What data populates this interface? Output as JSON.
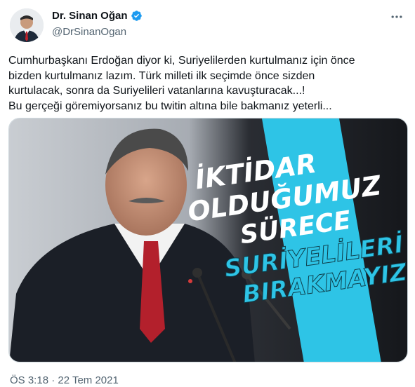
{
  "tweet": {
    "author_name": "Dr. Sinan Oğan",
    "handle": "@DrSinanOgan",
    "verified_icon": "verified-badge-icon",
    "more_icon": "more-horizontal-icon",
    "text_lines": [
      "Cumhurbaşkanı Erdoğan diyor ki, Suriyelilerden kurtulmanız için önce",
      "bizden kurtulmanız lazım. Türk milleti ilk seçimde önce sizden",
      "kurtulacak, sonra da Suriyelileri vatanlarına kavuşturacak...!",
      "Bu gerçeği göremiyorsanız bu twitin altına bile bakmanız yeterli..."
    ],
    "timestamp": "ÖS 3:18 · 22 Tem 2021"
  },
  "media": {
    "lines": [
      "İKTİDAR",
      "OLDUĞUMUZ",
      "SÜRECE",
      "SURİYELİLERİ",
      "BIRAKMAYIZ"
    ]
  },
  "colors": {
    "accent": "#1d9bf0",
    "cyan_bar": "#2ec4e6",
    "secondary_text": "#536471"
  }
}
